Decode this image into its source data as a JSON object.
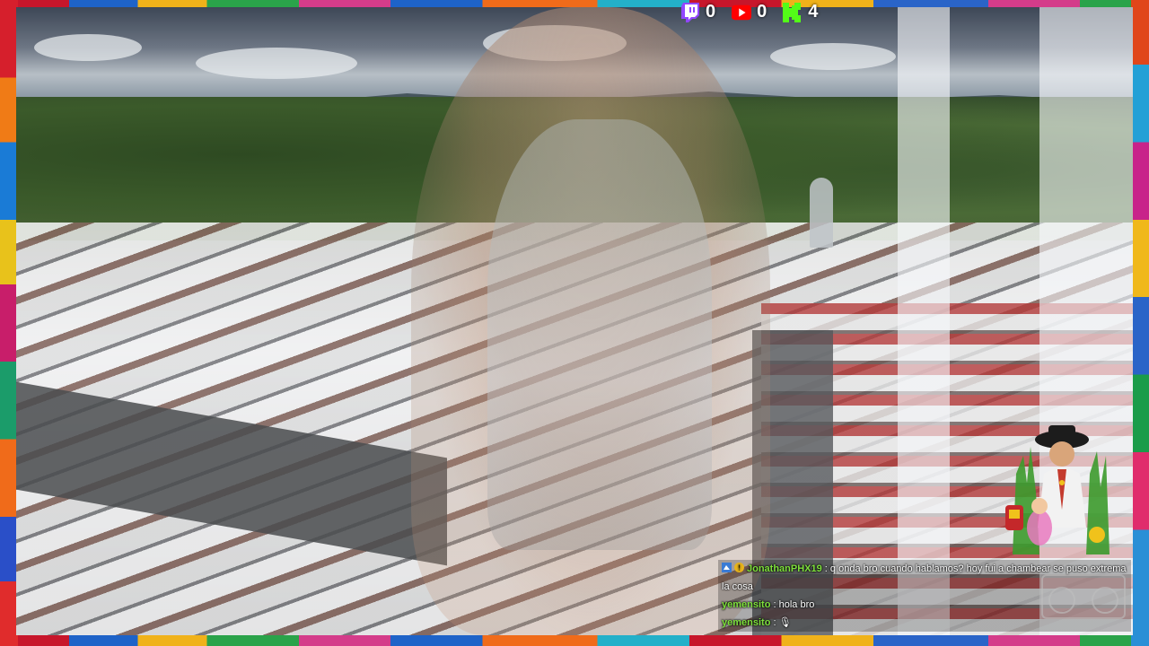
{
  "stream": {
    "stats": [
      {
        "platform": "twitch",
        "icon": "twitch-icon",
        "count": "0",
        "color": "#9146ff"
      },
      {
        "platform": "youtube",
        "icon": "youtube-icon",
        "count": "0",
        "color": "#ff0000"
      },
      {
        "platform": "kick",
        "icon": "kick-icon",
        "count": "4",
        "color": "#53fc18"
      }
    ]
  },
  "chat": {
    "messages": [
      {
        "user": "JonathanPHX19",
        "separator": " : ",
        "text": "q onda bro cuando hablamos? hoy fui a chambear se puso extrema la cosa",
        "user_color": "#7ee03c"
      },
      {
        "user": "yemensito",
        "separator": " : ",
        "text": "hola bro",
        "user_color": "#7ee03c"
      },
      {
        "user": "yemensito",
        "separator": " : ",
        "text": "🎙",
        "user_color": "#7ee03c"
      }
    ]
  },
  "colors": {
    "accent": "#7ee03c"
  }
}
